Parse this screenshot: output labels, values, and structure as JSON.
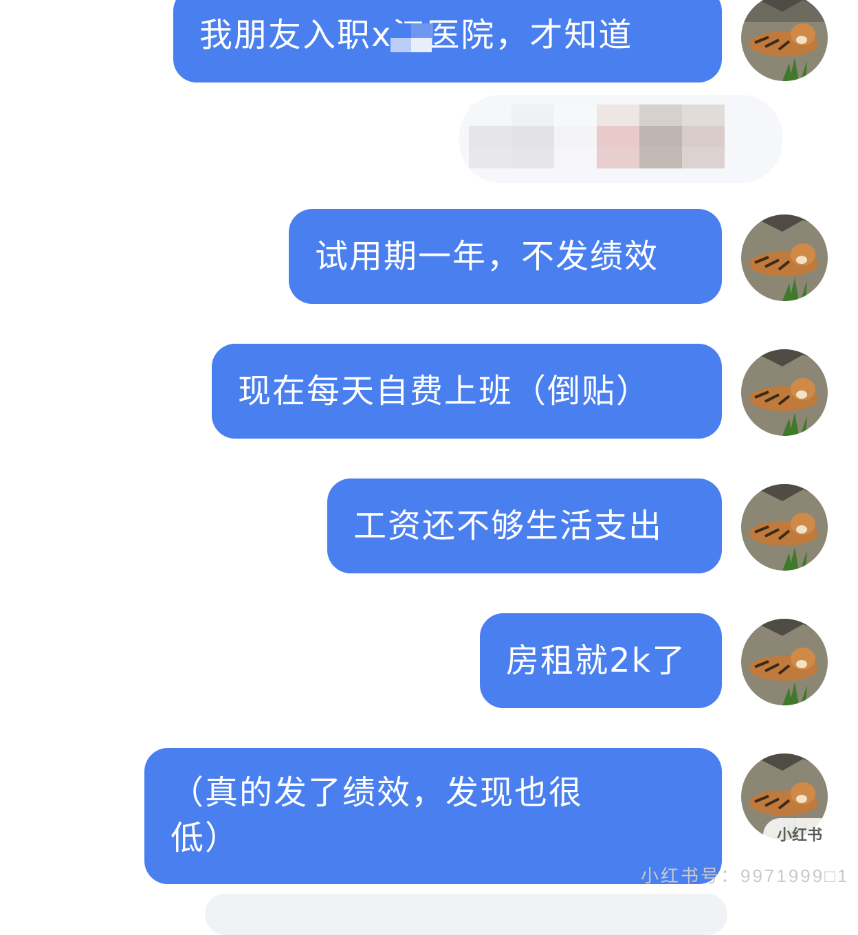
{
  "chat": {
    "messages": [
      {
        "text": "我朋友入职x江医院，才知道"
      },
      {
        "text": "试用期一年，不发绩效"
      },
      {
        "text": "现在每天自费上班（倒贴）"
      },
      {
        "text": "工资还不够生活支出"
      },
      {
        "text": "房租就2k了"
      },
      {
        "text": "（真的发了绩效，发现也很\n低）"
      }
    ],
    "avatar_icon": "tiger-avatar-icon",
    "bubble_color": "#4a7ff0",
    "bubble_text_color": "#ffffff"
  },
  "watermark": {
    "badge": "小红书",
    "id": "小红书号：9971999□1"
  }
}
